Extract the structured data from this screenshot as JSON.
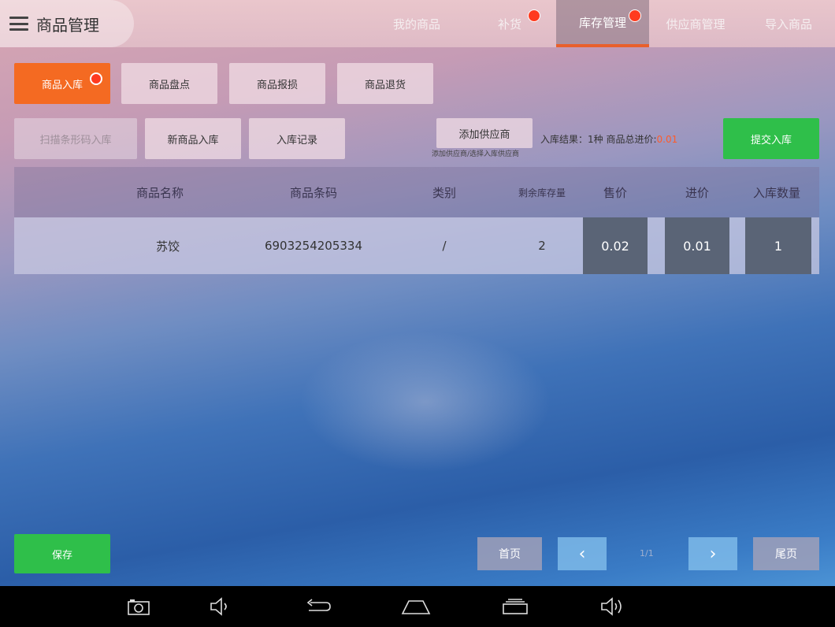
{
  "app": {
    "title": "商品管理",
    "tabs": [
      {
        "label": "我的商品"
      },
      {
        "label": "补货"
      },
      {
        "label": "库存管理"
      },
      {
        "label": "供应商管理"
      },
      {
        "label": "导入商品"
      }
    ],
    "active_tab": "库存管理"
  },
  "subtabs": {
    "items": [
      {
        "label": "商品入库"
      },
      {
        "label": "商品盘点"
      },
      {
        "label": "商品报损"
      },
      {
        "label": "商品退货"
      }
    ]
  },
  "actions": {
    "scan_in": "扫描条形码入库",
    "new_in": "新商品入库",
    "records": "入库记录",
    "add_supplier": "添加供应商",
    "supplier_hint": "添加供应商/选择入库供应商",
    "summary_prefix": "入库结果：1种",
    "summary_middle": "商品总进价:",
    "summary_amount": "0.01",
    "submit": "提交入库"
  },
  "table": {
    "headers": [
      "商品名称",
      "商品条码",
      "类别",
      "剩余库存量",
      "售价",
      "进价",
      "入库数量"
    ],
    "rows": [
      {
        "name": "苏饺",
        "barcode": "6903254205334",
        "category": "/",
        "stock": "2",
        "price": "0.02",
        "cost": "0.01",
        "qty": "1"
      }
    ]
  },
  "footer": {
    "save": "保存",
    "first": "首页",
    "prev": "‹",
    "page": "1/1",
    "next": "›",
    "last": "尾页"
  },
  "system_bar": {
    "icons": [
      "camera-icon",
      "volume-down-icon",
      "back-icon",
      "home-icon",
      "recents-icon",
      "volume-up-icon"
    ]
  },
  "colors": {
    "accent": "#f46a22",
    "success": "#2fbf4a",
    "badge": "#ff3b1f"
  }
}
